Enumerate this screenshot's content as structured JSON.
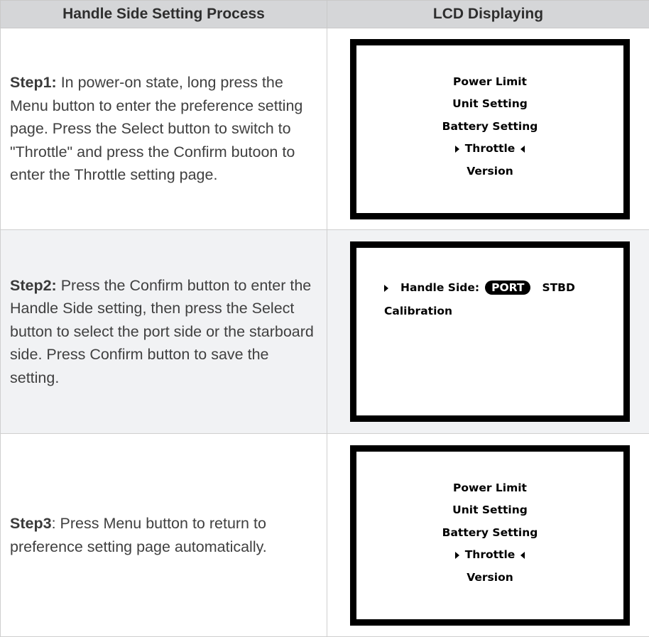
{
  "header": {
    "col1": "Handle Side Setting Process",
    "col2": "LCD Displaying"
  },
  "steps": [
    {
      "label": "Step1:",
      "text": " In power-on state, long press the Menu button to enter the preference setting page. Press the Select button to switch to \"Throttle\" and press the Confirm butoon to enter the Throttle setting page."
    },
    {
      "label": "Step2:",
      "text": " Press the Confirm button to enter the Handle Side setting, then press the Select button to select the port side or the starboard side. Press Confirm button to save the setting."
    },
    {
      "label": "Step3",
      "text": ": Press Menu button to return to preference setting page automatically."
    }
  ],
  "lcd_menu": {
    "items": [
      "Power Limit",
      "Unit Setting",
      "Battery Setting",
      "Throttle",
      "Version"
    ],
    "selected": "Throttle"
  },
  "lcd_throttle": {
    "handle_side_label": "Handle Side:",
    "option_selected": "PORT",
    "option_other": "STBD",
    "calibration": "Calibration"
  },
  "colors": {
    "header_bg": "#d5d6d8",
    "shaded_row_bg": "#f1f2f4",
    "lcd_border": "#000000"
  }
}
